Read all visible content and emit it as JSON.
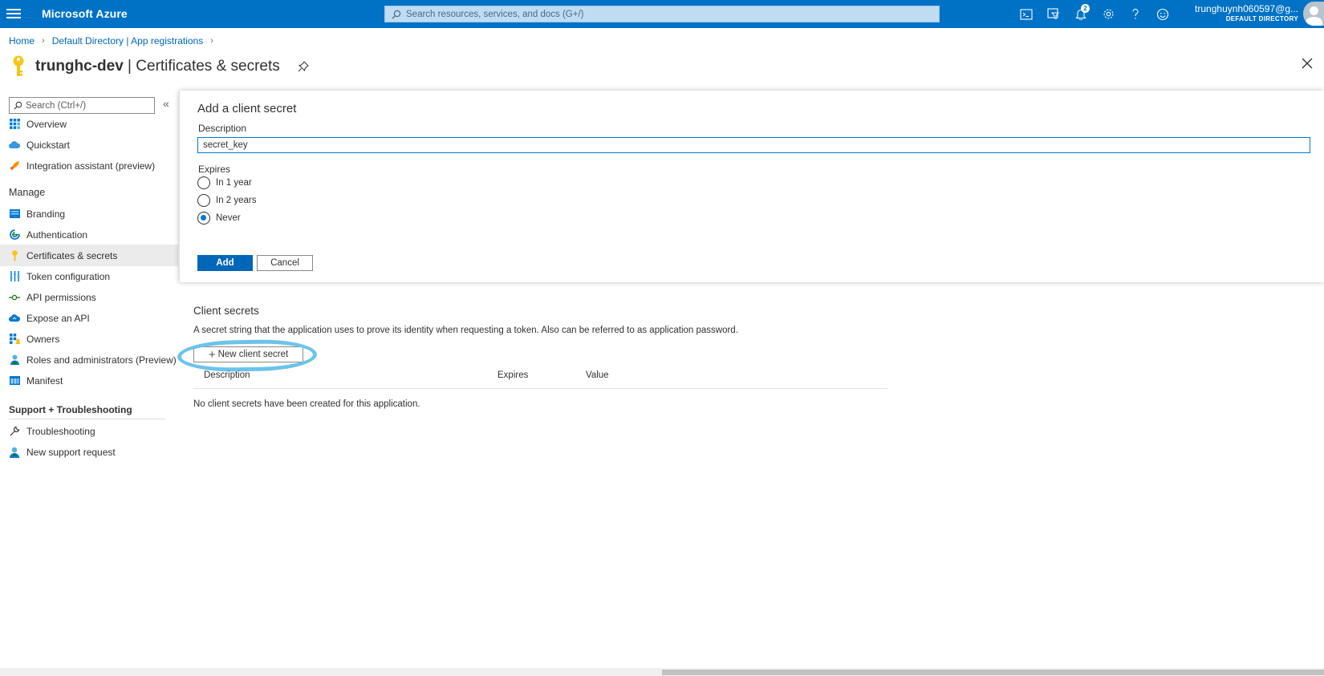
{
  "topbar": {
    "brand": "Microsoft Azure",
    "search_placeholder": "Search resources, services, and docs (G+/)",
    "notification_count": "2",
    "account_name": "trunghuynh060597@g...",
    "account_directory": "DEFAULT DIRECTORY",
    "icons": [
      "cloud-shell-icon",
      "directory-filter-icon",
      "notifications-icon",
      "settings-icon",
      "help-icon",
      "feedback-icon"
    ]
  },
  "breadcrumb": [
    "Home",
    "Default Directory | App registrations"
  ],
  "page": {
    "title_app": "trunghc-dev",
    "title_section": " | Certificates & secrets"
  },
  "sidebar": {
    "search_placeholder": "Search (Ctrl+/)",
    "collapse_glyph": "«",
    "items_top": [
      {
        "label": "Overview",
        "icon": "overview-icon"
      },
      {
        "label": "Quickstart",
        "icon": "quickstart-icon"
      },
      {
        "label": "Integration assistant (preview)",
        "icon": "rocket-icon"
      }
    ],
    "manage_heading": "Manage",
    "items_manage": [
      {
        "label": "Branding",
        "icon": "branding-icon"
      },
      {
        "label": "Authentication",
        "icon": "authentication-icon"
      },
      {
        "label": "Certificates & secrets",
        "icon": "key-icon",
        "active": true
      },
      {
        "label": "Token configuration",
        "icon": "token-config-icon"
      },
      {
        "label": "API permissions",
        "icon": "api-permissions-icon"
      },
      {
        "label": "Expose an API",
        "icon": "cloud-icon"
      },
      {
        "label": "Owners",
        "icon": "owners-icon"
      },
      {
        "label": "Roles and administrators (Preview)",
        "icon": "roles-icon"
      },
      {
        "label": "Manifest",
        "icon": "manifest-icon"
      }
    ],
    "support_heading": "Support + Troubleshooting",
    "items_support": [
      {
        "label": "Troubleshooting",
        "icon": "wrench-icon"
      },
      {
        "label": "New support request",
        "icon": "support-person-icon"
      }
    ]
  },
  "add_secret_panel": {
    "title": "Add a client secret",
    "description_label": "Description",
    "description_value": "secret_key",
    "expires_label": "Expires",
    "options": [
      "In 1 year",
      "In 2 years",
      "Never"
    ],
    "selected_option": "Never",
    "add_label": "Add",
    "cancel_label": "Cancel"
  },
  "client_secrets": {
    "title": "Client secrets",
    "description": "A secret string that the application uses to prove its identity when requesting a token. Also can be referred to as application password.",
    "new_button_label": "New client secret",
    "columns": [
      "Description",
      "Expires",
      "Value"
    ],
    "empty_message": "No client secrets have been created for this application."
  },
  "colors": {
    "topbar": "#0072c6",
    "accent": "#0078d4",
    "highlight_ring": "#6cc3ec"
  }
}
